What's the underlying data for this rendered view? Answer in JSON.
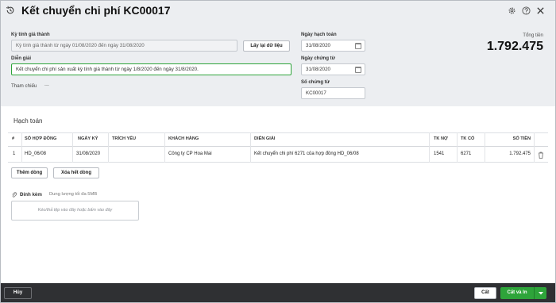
{
  "header": {
    "title": "Kết chuyển chi phí KC00017"
  },
  "form": {
    "ky_tinh_label": "Kỳ tính giá thành",
    "ky_tinh_value": "Kỳ tính giá thành từ ngày 01/08/2020 đến ngày 31/08/2020",
    "lay_lai_button": "Lấy lại dữ liệu",
    "dien_giai_label": "Diễn giải",
    "dien_giai_value": "Kết chuyển chi phí sản xuất kỳ tính giá thành từ ngày 1/8/2020 đến ngày 31/8/2020.",
    "tham_chieu_label": "Tham chiếu",
    "tham_chieu_more": "...",
    "ngay_hach_toan_label": "Ngày hạch toán",
    "ngay_hach_toan_value": "31/08/2020",
    "ngay_chung_tu_label": "Ngày chứng từ",
    "ngay_chung_tu_value": "31/08/2020",
    "so_chung_tu_label": "Số chứng từ",
    "so_chung_tu_value": "KC00017"
  },
  "total": {
    "label": "Tổng tiền",
    "value": "1.792.475"
  },
  "section": {
    "title": "Hạch toán"
  },
  "table": {
    "headers": [
      "#",
      "SỐ HỢP ĐỒNG",
      "NGÀY KÝ",
      "TRÍCH YẾU",
      "KHÁCH HÀNG",
      "DIỄN GIẢI",
      "TK NỢ",
      "TK CÓ",
      "SỐ TIỀN"
    ],
    "rows": [
      [
        "1",
        "HD_06/08",
        "31/08/2020",
        "",
        "Công ty CP Hoa Mai",
        "Kết chuyển chi phí 6271 của hợp đồng HD_06/08",
        "1541",
        "6271",
        "1.792.475"
      ]
    ]
  },
  "actions": {
    "add_row": "Thêm dòng",
    "clear_rows": "Xóa hết dòng"
  },
  "attachment": {
    "label": "Đính kèm",
    "limit": "Dung lượng tối đa 5MB",
    "drop_text": "Kéo/thả tệp vào đây hoặc bấm vào đây"
  },
  "footer": {
    "cancel": "Hủy",
    "save": "Cất",
    "save_print": "Cất và In"
  },
  "colors": {
    "accent": "#2ea43a",
    "footer_bg": "#2f3033",
    "header_bg": "#eceef1"
  }
}
